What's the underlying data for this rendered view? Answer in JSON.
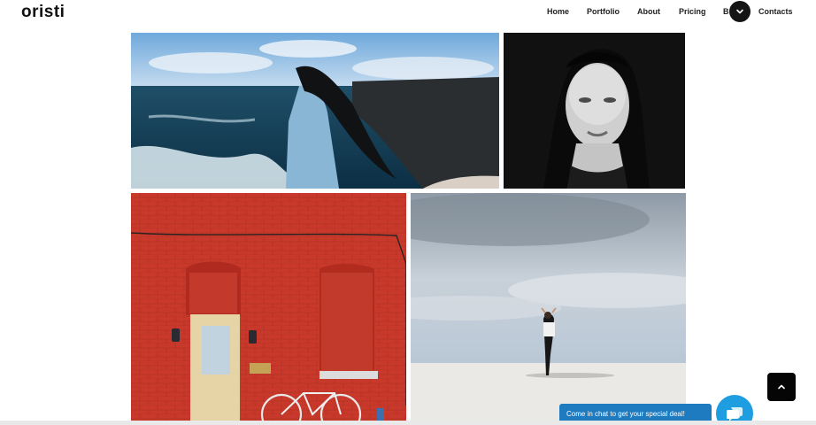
{
  "brand": {
    "logo_text": "oristi"
  },
  "nav": {
    "items": [
      {
        "label": "Home"
      },
      {
        "label": "Portfolio"
      },
      {
        "label": "About"
      },
      {
        "label": "Pricing"
      },
      {
        "label": "B"
      },
      {
        "label": "Contacts"
      }
    ]
  },
  "icons": {
    "dropdown": "chevron-down-icon",
    "scroll_top": "chevron-up-icon",
    "chat": "chat-bubble-icon"
  },
  "gallery": {
    "items": [
      {
        "name": "gallery-photo-woman-coast"
      },
      {
        "name": "gallery-photo-woman-portrait"
      },
      {
        "name": "gallery-photo-red-brick-wall"
      },
      {
        "name": "gallery-photo-woman-sand"
      }
    ]
  },
  "chat": {
    "banner_text": "Come in chat to get your special deal!"
  },
  "colors": {
    "chat_accent": "#1e9ee0",
    "chat_banner": "#1f7bbf",
    "dark": "#141414"
  }
}
